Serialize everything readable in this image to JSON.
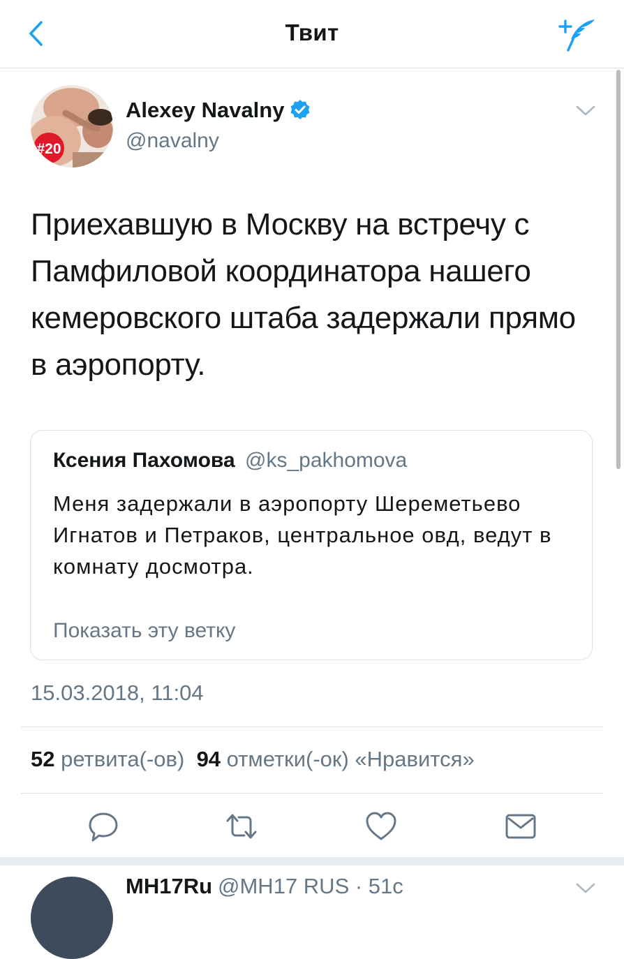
{
  "header": {
    "title": "Твит",
    "back_icon": "chevron-left-icon",
    "compose_icon": "compose-feather-icon",
    "accent_color": "#1da1f2"
  },
  "tweet": {
    "author_name": "Alexey Navalny",
    "author_handle": "@navalny",
    "verified": true,
    "avatar_badge": "#20",
    "text": "Приехавшую в Москву на встречу с Памфиловой координатора нашего кемеровского штаба задержали прямо в аэропорту.",
    "quote": {
      "name": "Ксения Пахомова",
      "handle": "@ks_pakhomova",
      "text": "Меня задержали в аэропорту Шереметьево Игнатов и Петраков, центральное овд, ведут в комнату досмотра.",
      "show_thread": "Показать эту ветку"
    },
    "timestamp": "15.03.2018, 11:04",
    "stats": {
      "retweets_count": "52",
      "retweets_label": "ретвита(-ов)",
      "likes_count": "94",
      "likes_label": "отметки(-ок) «Нравится»"
    },
    "actions": [
      "reply-icon",
      "retweet-icon",
      "like-icon",
      "share-icon"
    ]
  },
  "next_tweet": {
    "author_name": "MH17Ru",
    "meta": "@MH17 RUS · 51с"
  }
}
